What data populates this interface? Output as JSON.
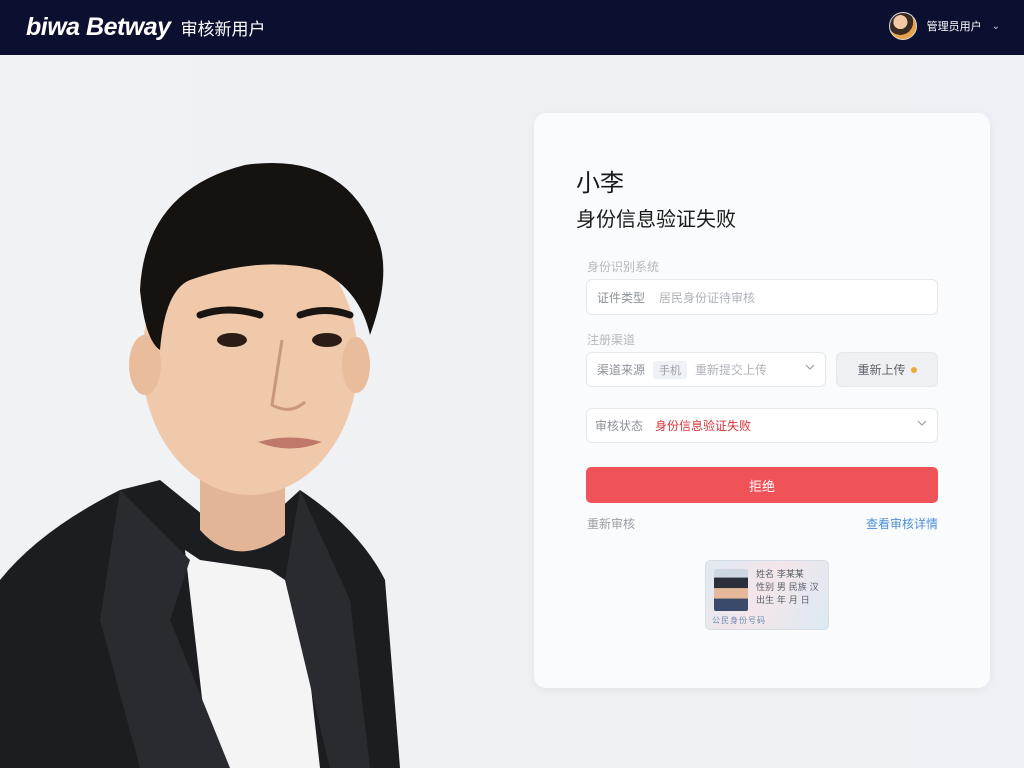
{
  "header": {
    "logo": "biwa Betway",
    "title": "审核新用户",
    "user_name": "管理员用户"
  },
  "card": {
    "name": "小李",
    "status_title": "身份信息验证失败",
    "field1_label": "身份识别系统",
    "field1_prefix": "证件类型",
    "field1_value": "居民身份证待审核",
    "field2_label": "注册渠道",
    "field2_prefix": "渠道来源",
    "field2_tag": "手机",
    "field2_value": "重新提交上传",
    "field2_button": "重新上传",
    "status_prefix": "审核状态",
    "status_value": "身份信息验证失败",
    "primary_button": "拒绝",
    "link_left": "重新审核",
    "link_right": "查看审核详情",
    "id_card_lines": [
      "姓名 李某某",
      "性别 男 民族 汉",
      "出生 年 月 日"
    ],
    "id_card_number": "公民身份号码"
  },
  "colors": {
    "topbar": "#0b1030",
    "primary": "#ef5357",
    "error": "#d5353a",
    "link": "#4e8fd6"
  }
}
